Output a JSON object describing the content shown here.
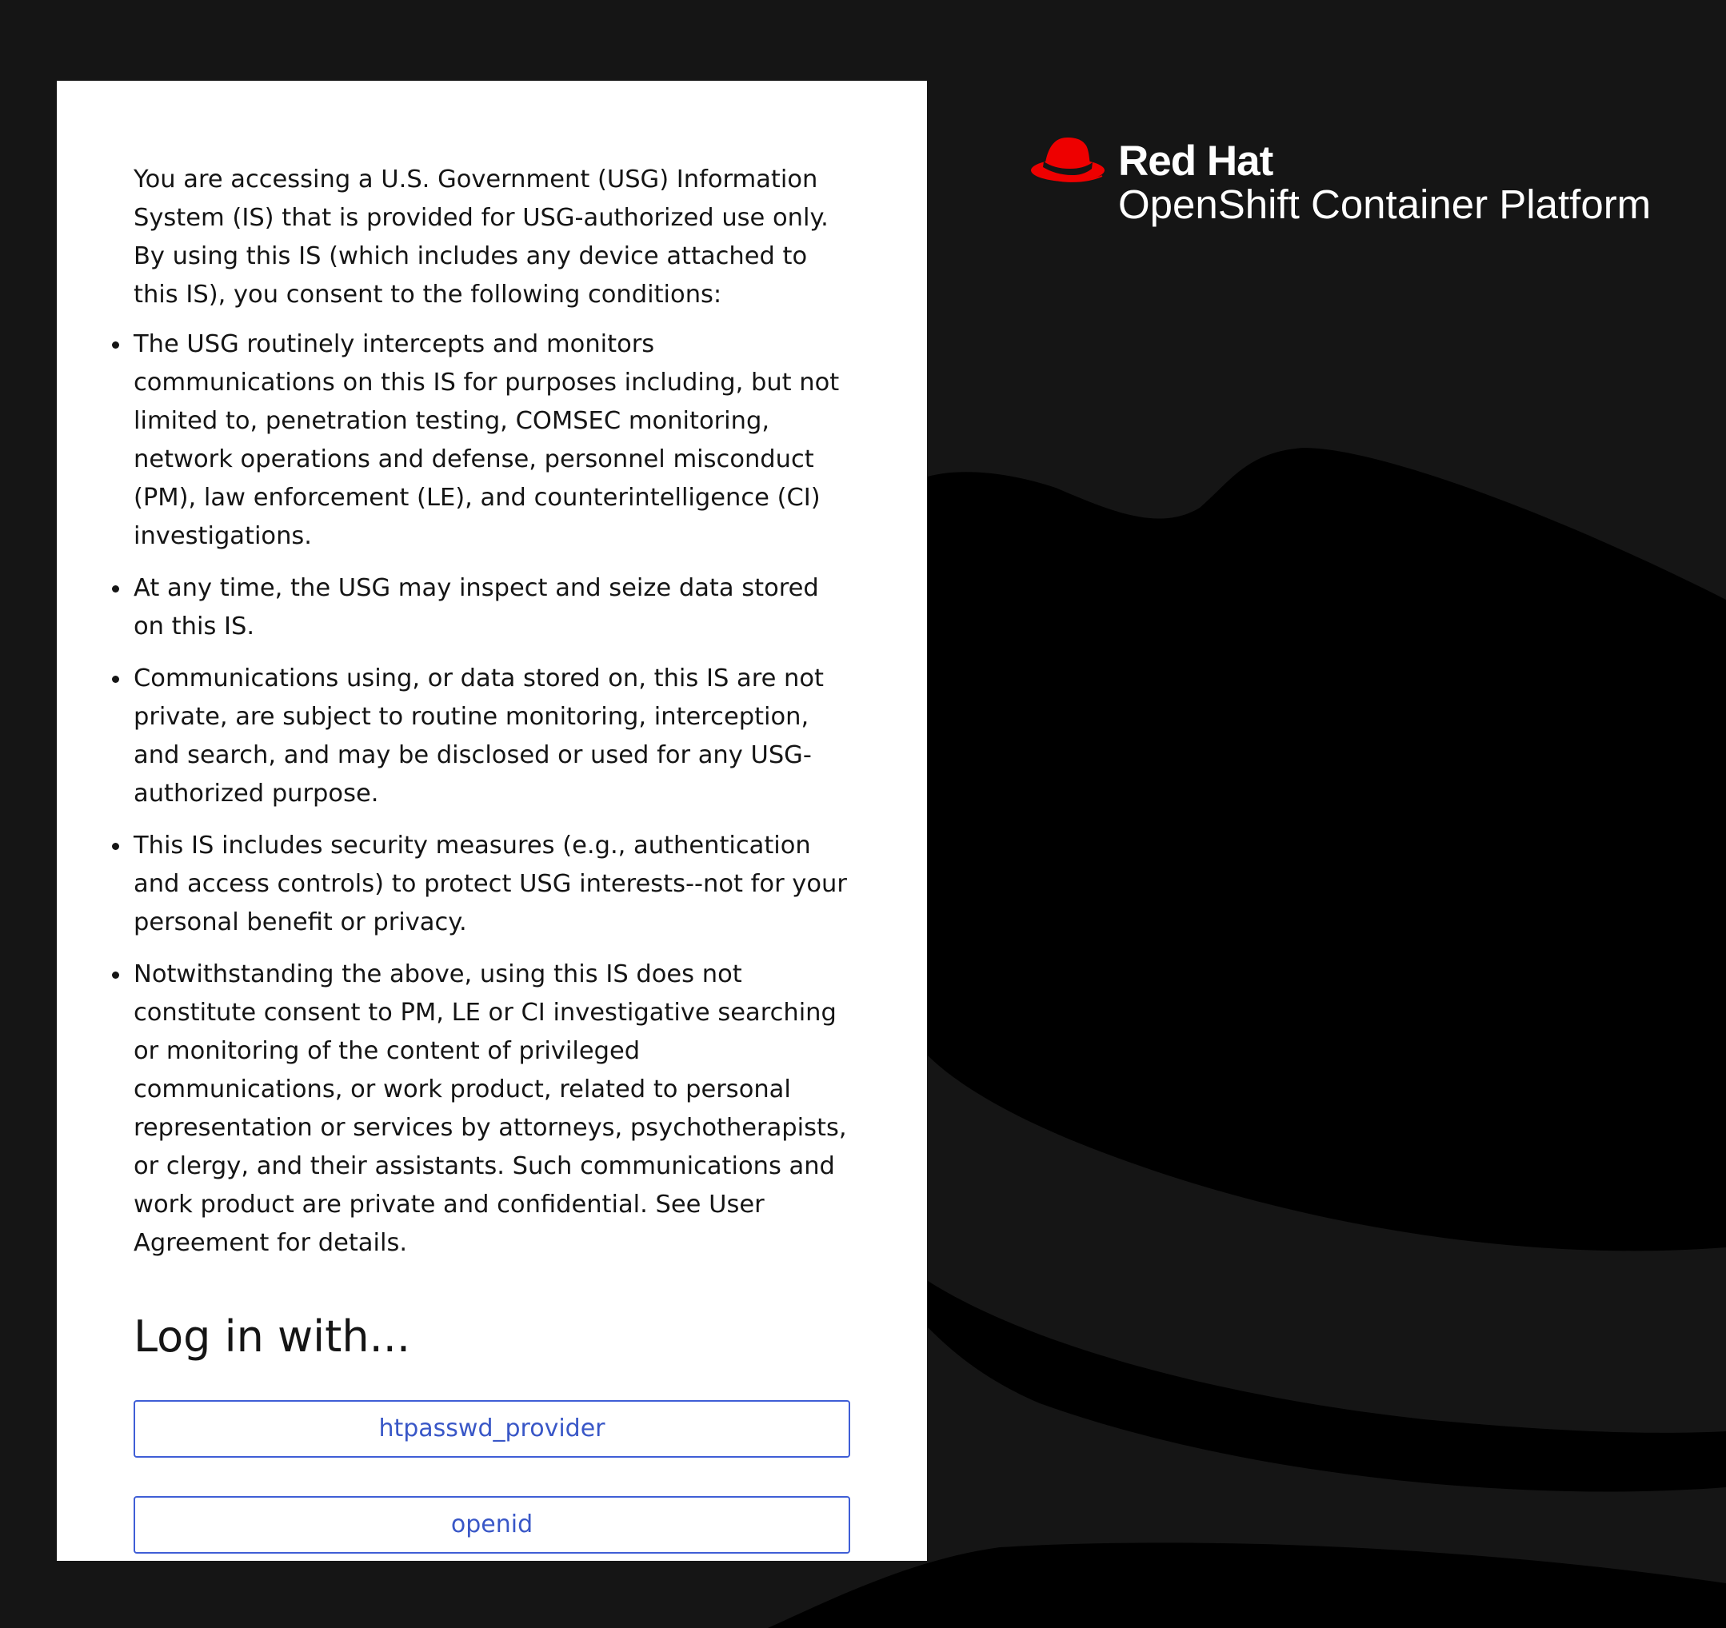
{
  "background": {
    "color": "#151515",
    "shape_color": "#000000"
  },
  "notice": {
    "intro": "You are accessing a U.S. Government (USG) Information System (IS) that is provided for USG-authorized use only. By using this IS (which includes any device attached to this IS), you consent to the following conditions:",
    "items": [
      "The USG routinely intercepts and monitors communications on this IS for purposes including, but not limited to, penetration testing, COMSEC monitoring, network operations and defense, personnel misconduct (PM), law enforcement (LE), and counterintelligence (CI) investigations.",
      "At any time, the USG may inspect and seize data stored on this IS.",
      "Communications using, or data stored on, this IS are not private, are subject to routine monitoring, interception, and search, and may be disclosed or used for any USG-authorized purpose.",
      "This IS includes security measures (e.g., authentication and access controls) to protect USG interests--not for your personal benefit or privacy.",
      "Notwithstanding the above, using this IS does not constitute consent to PM, LE or CI investigative searching or monitoring of the content of privileged communications, or work product, related to personal representation or services by attorneys, psychotherapists, or clergy, and their assistants. Such communications and work product are private and confidential. See User Agreement for details."
    ]
  },
  "login": {
    "title": "Log in with...",
    "providers": [
      {
        "label": "htpasswd_provider"
      },
      {
        "label": "openid"
      }
    ],
    "button_color": "#3957c7"
  },
  "brand": {
    "company": "Red Hat",
    "product_strong": "OpenShift",
    "product_rest": " Container Platform",
    "hat_color": "#ee0000",
    "logo_icon": "red-hat-logo-icon"
  }
}
